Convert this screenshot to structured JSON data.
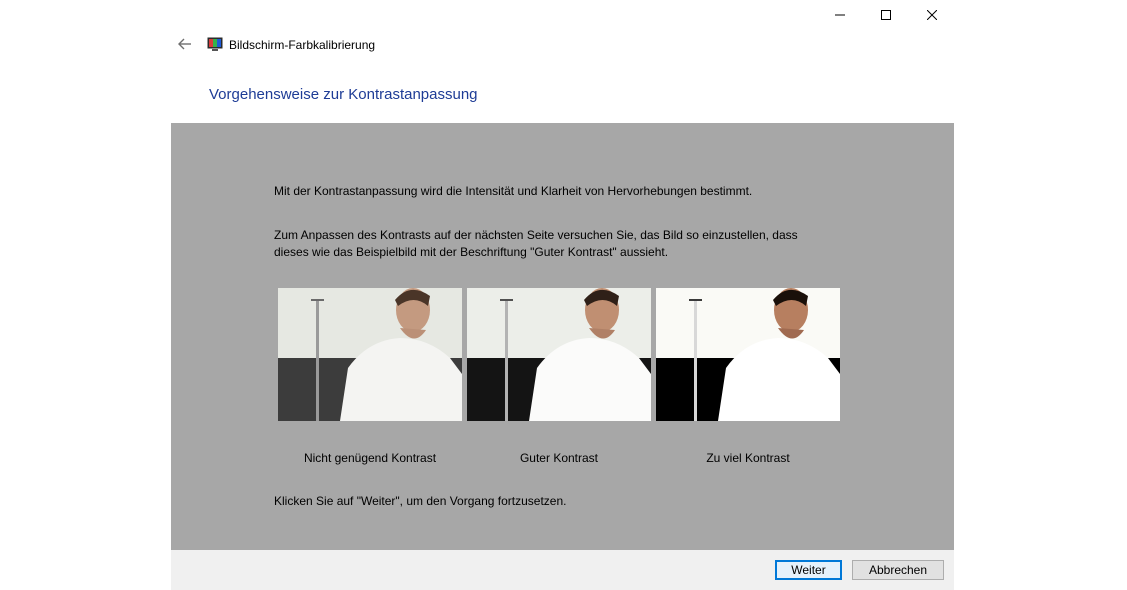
{
  "window": {
    "title": "Bildschirm-Farbkalibrierung",
    "controls": [
      "minimize-icon",
      "maximize-icon",
      "close-icon"
    ]
  },
  "page": {
    "title": "Vorgehensweise zur Kontrastanpassung",
    "intro": "Mit der Kontrastanpassung wird die Intensität und Klarheit von Hervorhebungen bestimmt.",
    "instruction": "Zum Anpassen des Kontrasts auf der nächsten Seite versuchen Sie, das Bild so einzustellen, dass dieses wie das Beispielbild mit der Beschriftung \"Guter Kontrast\" aussieht.",
    "continue_hint": "Klicken Sie auf \"Weiter\", um den Vorgang fortzusetzen."
  },
  "samples": [
    {
      "caption": "Nicht genügend Kontrast",
      "wall_color": "#3c3c3c",
      "bg_color": "#e6e8e2"
    },
    {
      "caption": "Guter Kontrast",
      "wall_color": "#141414",
      "bg_color": "#eceee9"
    },
    {
      "caption": "Zu viel Kontrast",
      "wall_color": "#000000",
      "bg_color": "#fafaf6"
    }
  ],
  "footer": {
    "next_label": "Weiter",
    "cancel_label": "Abbrechen"
  },
  "colors": {
    "title_blue": "#1e3c96",
    "panel_gray": "#a7a7a7",
    "footer_gray": "#f0f0f0",
    "focus_blue": "#0078d7"
  }
}
